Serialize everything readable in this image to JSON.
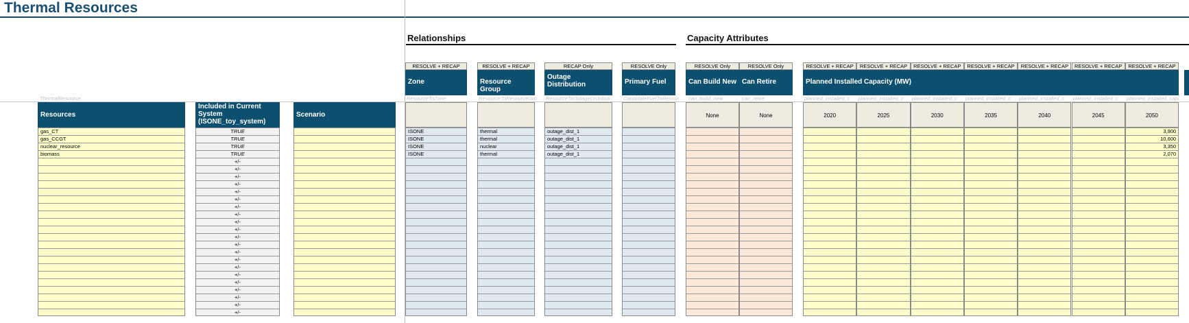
{
  "page_title": "Thermal Resources",
  "sections": {
    "relationships": "Relationships",
    "capacity": "Capacity Attributes"
  },
  "left_attr": "ThermalResource",
  "left_headers": {
    "resources": "Resources",
    "included": "Included in Current System (ISONE_toy_system)",
    "scenario": "Scenario"
  },
  "rel_columns": [
    {
      "tag": "RESOLVE + RECAP",
      "header": "Zone",
      "attr": "ResourceToZone"
    },
    {
      "tag": "RESOLVE + RECAP",
      "header": "Resource Group",
      "attr": "ResourceToResourceGro"
    },
    {
      "tag": "RECAP Only",
      "header": "Outage Distribution",
      "attr": "ResourceToOutageDistributi"
    },
    {
      "tag": "RESOLVE Only",
      "header": "Primary Fuel",
      "attr": "CandidateFuelToResour"
    }
  ],
  "build": [
    {
      "tag": "RESOLVE Only",
      "header": "Can Build New",
      "attr": "can_build_new",
      "sub": "None"
    },
    {
      "tag": "RESOLVE Only",
      "header": "Can Retire",
      "attr": "can_retire",
      "sub": "None"
    }
  ],
  "planned": {
    "tags": [
      "RESOLVE + RECAP",
      "RESOLVE + RECAP",
      "RESOLVE + RECAP",
      "RESOLVE + RECAP",
      "RESOLVE + RECAP",
      "RESOLVE + RECAP",
      "RESOLVE + RECAP"
    ],
    "header": "Planned Installed Capacity (MW)",
    "attr": "planned_installed_c",
    "last_attr": "planned_installed_capa",
    "years": [
      "2020",
      "2025",
      "2030",
      "2035",
      "2040",
      "2045",
      "2050"
    ],
    "values_2050": [
      "3,900",
      "10,600",
      "3,350",
      "2,070"
    ]
  },
  "rows": [
    {
      "resource": "gas_CT",
      "included": "TRUE",
      "zone": "ISONE",
      "group": "thermal",
      "outage": "outage_dist_1"
    },
    {
      "resource": "gas_CCGT",
      "included": "TRUE",
      "zone": "ISONE",
      "group": "thermal",
      "outage": "outage_dist_1"
    },
    {
      "resource": "nuclear_resource",
      "included": "TRUE",
      "zone": "ISONE",
      "group": "nuclear",
      "outage": "outage_dist_1"
    },
    {
      "resource": "biomass",
      "included": "TRUE",
      "zone": "ISONE",
      "group": "thermal",
      "outage": "outage_dist_1"
    }
  ],
  "empty_included": "+/-",
  "total_rows": 25
}
